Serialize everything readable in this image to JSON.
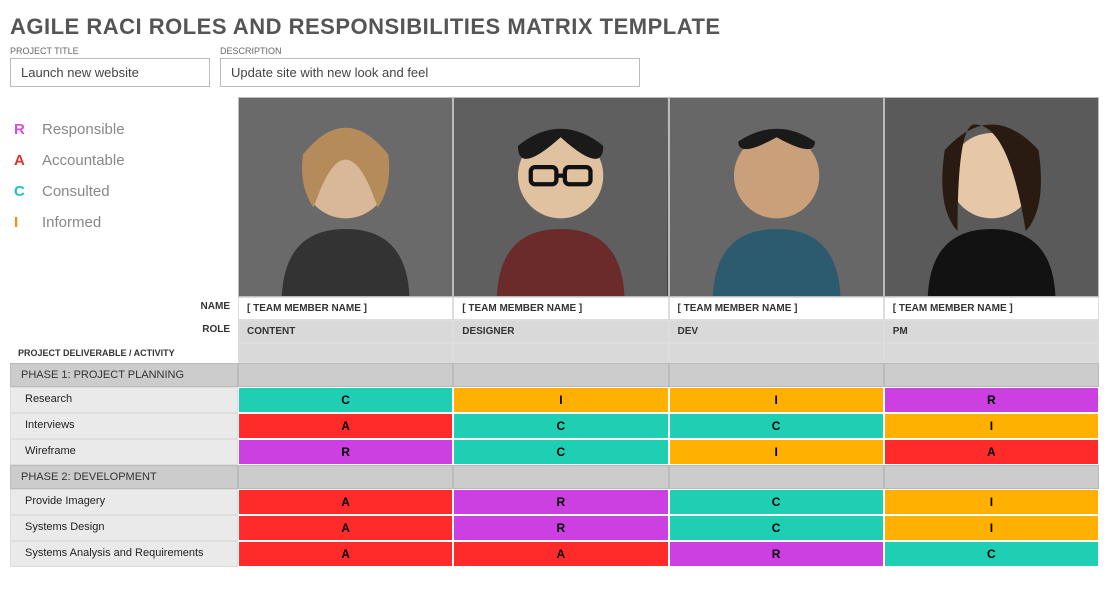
{
  "page_title": "AGILE RACI ROLES AND RESPONSIBILITIES MATRIX TEMPLATE",
  "meta": {
    "project_title_label": "PROJECT TITLE",
    "project_title": "Launch new website",
    "description_label": "DESCRIPTION",
    "description": "Update site with new look and feel"
  },
  "legend": {
    "R": "Responsible",
    "A": "Accountable",
    "C": "Consulted",
    "I": "Informed"
  },
  "headers": {
    "name_label": "NAME",
    "role_label": "ROLE",
    "deliverable_label": "PROJECT DELIVERABLE / ACTIVITY"
  },
  "team": [
    {
      "name": "[ TEAM MEMBER NAME ]",
      "role": "CONTENT"
    },
    {
      "name": "[ TEAM MEMBER NAME ]",
      "role": "DESIGNER"
    },
    {
      "name": "[ TEAM MEMBER NAME ]",
      "role": "DEV"
    },
    {
      "name": "[ TEAM MEMBER NAME ]",
      "role": "PM"
    }
  ],
  "phases": [
    {
      "title": "PHASE 1: PROJECT PLANNING",
      "rows": [
        {
          "activity": "Research",
          "cells": [
            "C",
            "I",
            "I",
            "R"
          ]
        },
        {
          "activity": "Interviews",
          "cells": [
            "A",
            "C",
            "C",
            "I"
          ]
        },
        {
          "activity": "Wireframe",
          "cells": [
            "R",
            "C",
            "I",
            "A"
          ]
        }
      ]
    },
    {
      "title": "PHASE 2: DEVELOPMENT",
      "rows": [
        {
          "activity": "Provide Imagery",
          "cells": [
            "A",
            "R",
            "C",
            "I"
          ]
        },
        {
          "activity": "Systems Design",
          "cells": [
            "A",
            "R",
            "C",
            "I"
          ]
        },
        {
          "activity": "Systems Analysis and Requirements",
          "cells": [
            "A",
            "A",
            "R",
            "C"
          ]
        }
      ]
    }
  ],
  "colors": {
    "R": "cR",
    "A": "cA",
    "C": "cC",
    "I": "cI"
  }
}
